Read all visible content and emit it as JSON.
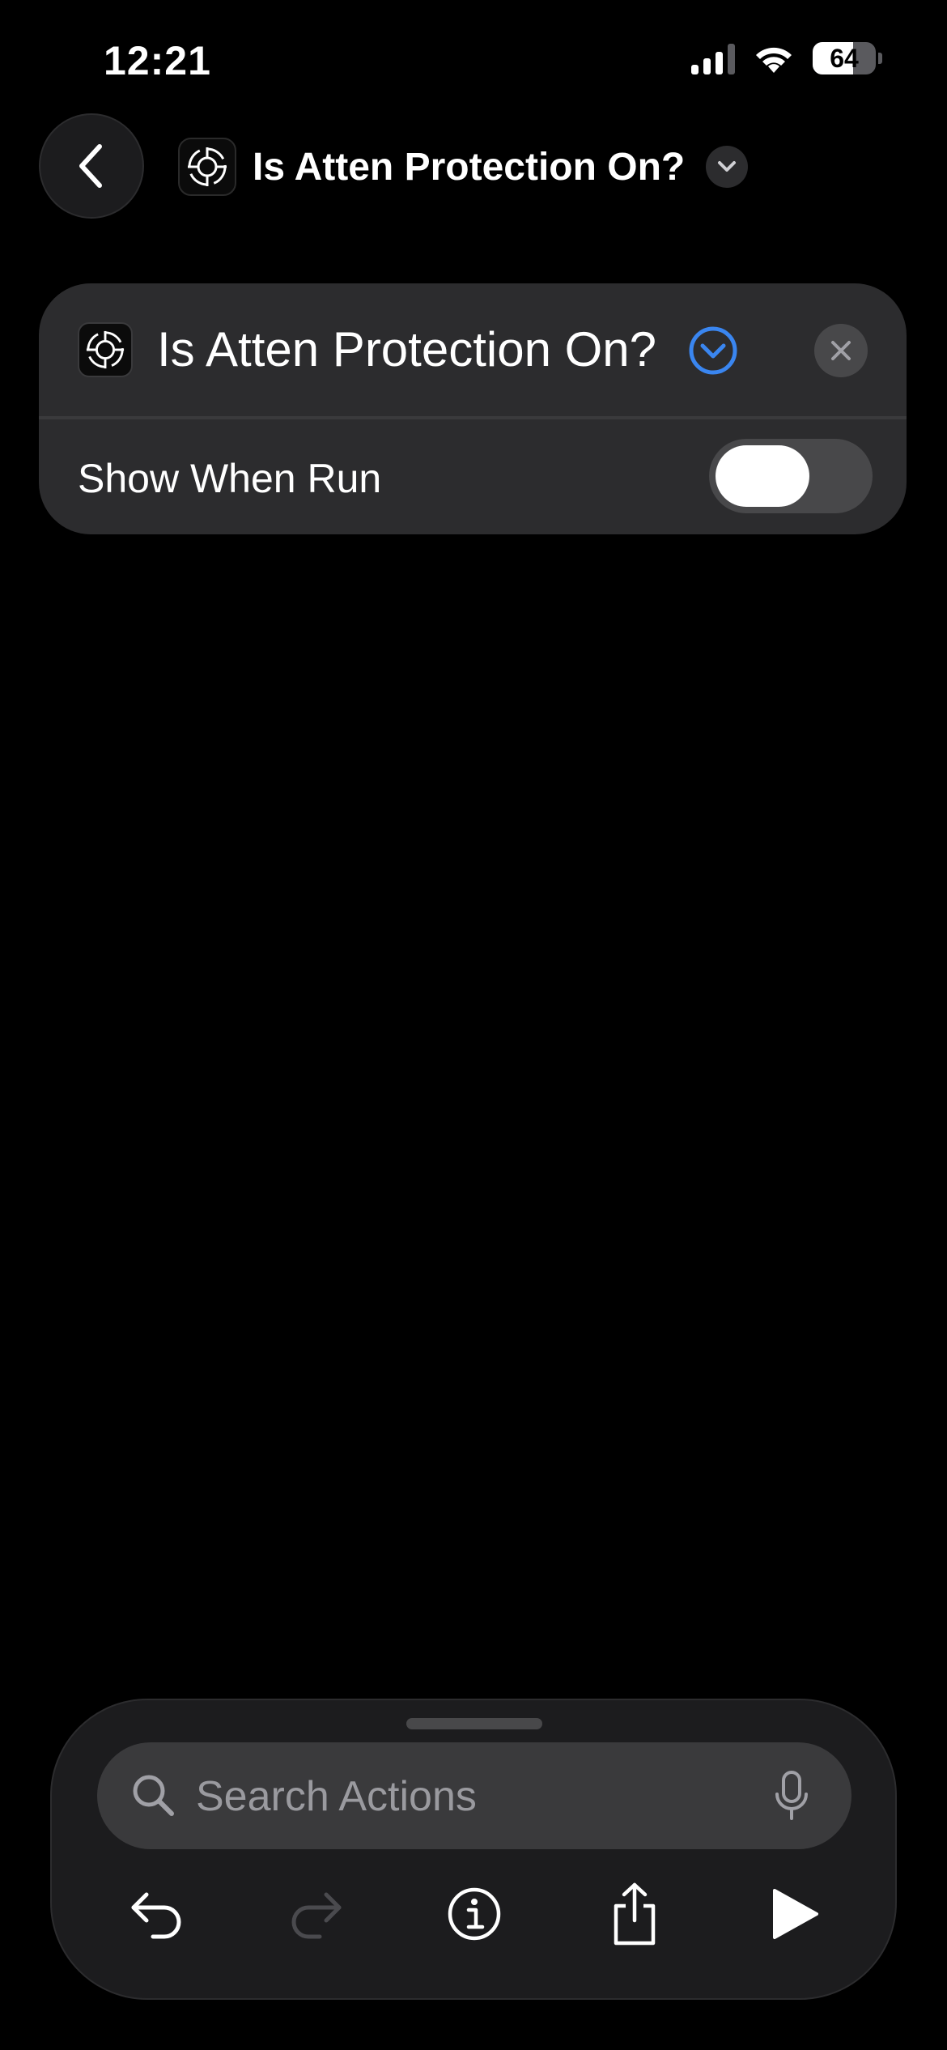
{
  "status_bar": {
    "time": "12:21",
    "battery_level": "64",
    "battery_fraction": 0.64,
    "signal_bars_active": 3,
    "signal_bars_total": 4
  },
  "header": {
    "title": "Is Atten Protection On?",
    "icon": "crosshair-target-icon"
  },
  "action_card": {
    "title": "Is Atten Protection On?",
    "icon": "crosshair-target-icon",
    "show_when_run_label": "Show When Run",
    "show_when_run_enabled": false
  },
  "bottom_panel": {
    "search_placeholder": "Search Actions",
    "toolbar": [
      "undo-icon",
      "redo-icon",
      "info-icon",
      "share-icon",
      "play-icon"
    ]
  },
  "colors": {
    "background": "#000000",
    "card": "#2c2c2e",
    "accent": "#3a86f0",
    "panel": "#1c1c1e"
  }
}
